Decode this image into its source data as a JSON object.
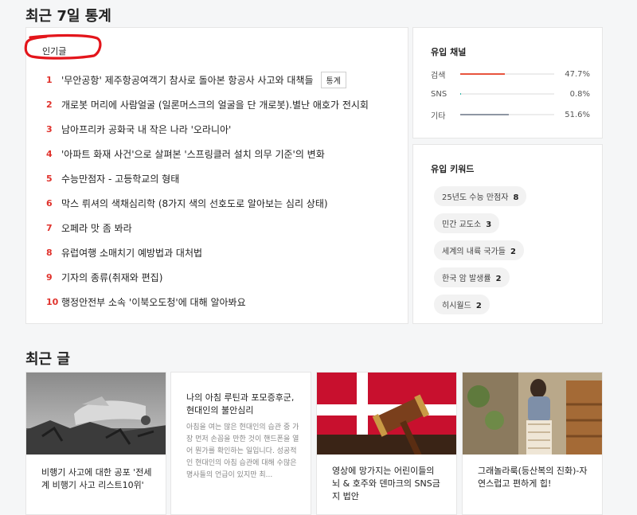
{
  "stats_title": "최근 7일 통계",
  "popular": {
    "tab_label": "인기글",
    "stats_button": "통계",
    "items": [
      {
        "rank": "1",
        "title": "'무안공항' 제주항공여객기 참사로 돌아본 항공사 사고와 대책들"
      },
      {
        "rank": "2",
        "title": "개로봇 머리에 사람얼굴 (일론머스크의 얼굴을 단 개로봇).별난 애호가 전시회"
      },
      {
        "rank": "3",
        "title": "남아프리카 공화국 내 작은 나라 '오라니아'"
      },
      {
        "rank": "4",
        "title": "'아파트 화재 사건'으로 살펴본 '스프링클러 설치 의무 기준'의 변화"
      },
      {
        "rank": "5",
        "title": "수능만점자 - 고등학교의 형태"
      },
      {
        "rank": "6",
        "title": "막스 뤼셔의 색채심리학 (8가지 색의 선호도로 알아보는 심리 상태)"
      },
      {
        "rank": "7",
        "title": "오페라 맛 좀 봐라"
      },
      {
        "rank": "8",
        "title": "유럽여행 소매치기 예방법과 대처법"
      },
      {
        "rank": "9",
        "title": "기자의 종류(취재와 편집)"
      },
      {
        "rank": "10",
        "title": "행정안전부 소속 '이북오도청'에 대해 알아봐요"
      }
    ]
  },
  "channels": {
    "title": "유입 채널",
    "items": [
      {
        "name": "검색",
        "percent_label": "47.7%",
        "value": 47.7,
        "color": "#e8543d"
      },
      {
        "name": "SNS",
        "percent_label": "0.8%",
        "value": 0.8,
        "color": "#2bb5a6"
      },
      {
        "name": "기타",
        "percent_label": "51.6%",
        "value": 51.6,
        "color": "#8e96a3"
      }
    ]
  },
  "keywords": {
    "title": "유입 키워드",
    "items": [
      {
        "label": "25년도 수능 만점자",
        "count": "8"
      },
      {
        "label": "민간 교도소",
        "count": "3"
      },
      {
        "label": "세계의 내륙 국가들",
        "count": "2"
      },
      {
        "label": "한국 암 발생률",
        "count": "2"
      },
      {
        "label": "히시월드",
        "count": "2"
      }
    ]
  },
  "recent": {
    "title": "최근 글",
    "posts": [
      {
        "title": "비행기 사고에 대한 공포 '전세계 비행기 사고 리스트10위'",
        "image": "plane-wreck-photo"
      },
      {
        "title": "나의 아침 루틴과 포모증후군, 현대인의 불안심리",
        "excerpt": "아침을 여는 많은 현대인의 습관 중 가장 먼저 손꼽을 만한 것이 핸드폰을 열어 뭔가를 확인하는 일입니다. 성공적인 현대인의 아침 습관에 대해 수많은 명사들의 언급이 있지만 최..."
      },
      {
        "title": "영상에 망가지는 어린이들의 뇌 & 호주와 덴마크의 SNS금지 법안",
        "image": "gavel-denmark-flag-photo"
      },
      {
        "title": "그래놀라룩(등산복의 진화)-자연스럽고 편하게 힙!",
        "image": "granola-look-fashion-photo"
      }
    ]
  }
}
